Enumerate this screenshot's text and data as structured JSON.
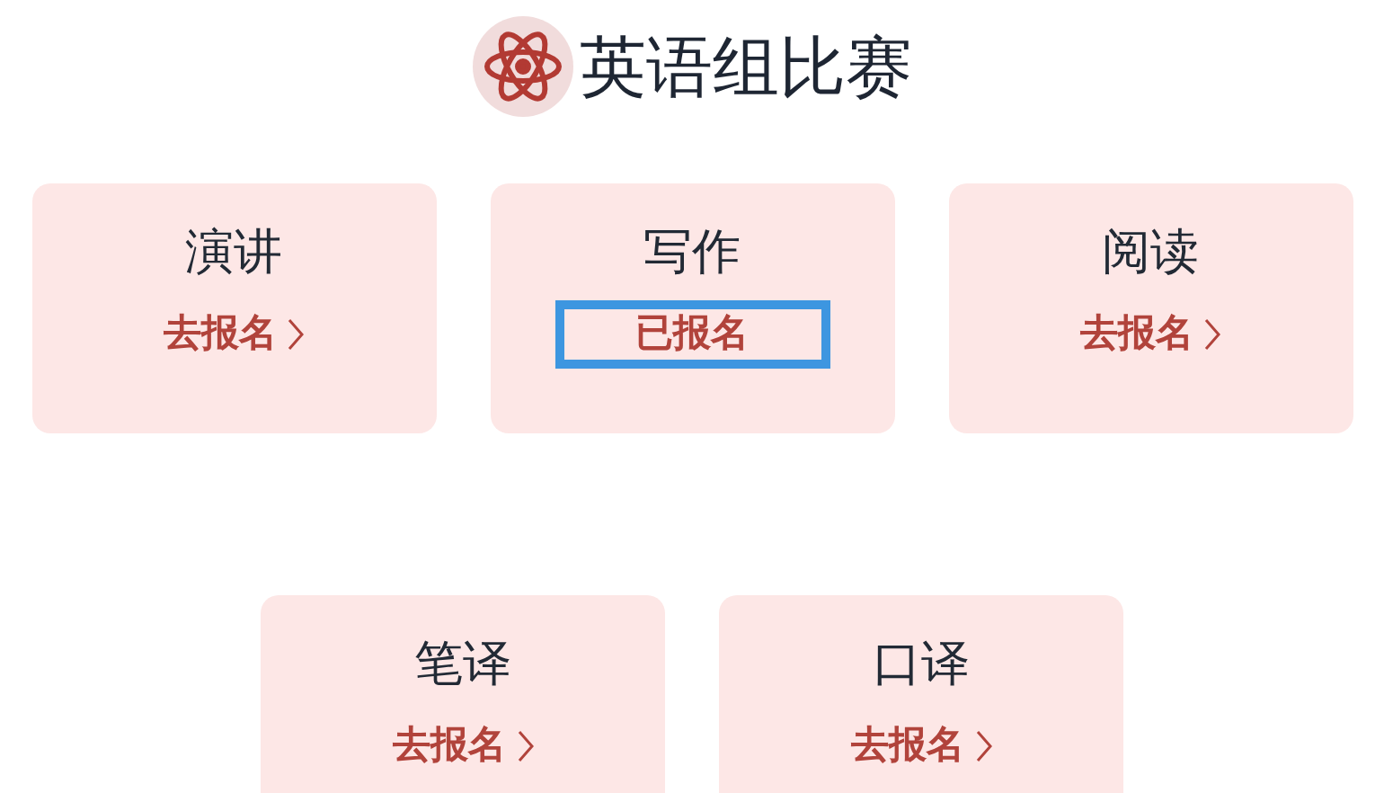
{
  "title": "英语组比赛",
  "contests": [
    {
      "name": "演讲",
      "action": "去报名",
      "registered": false
    },
    {
      "name": "写作",
      "action": "已报名",
      "registered": true
    },
    {
      "name": "阅读",
      "action": "去报名",
      "registered": false
    },
    {
      "name": "笔译",
      "action": "去报名",
      "registered": false
    },
    {
      "name": "口译",
      "action": "去报名",
      "registered": false
    }
  ]
}
